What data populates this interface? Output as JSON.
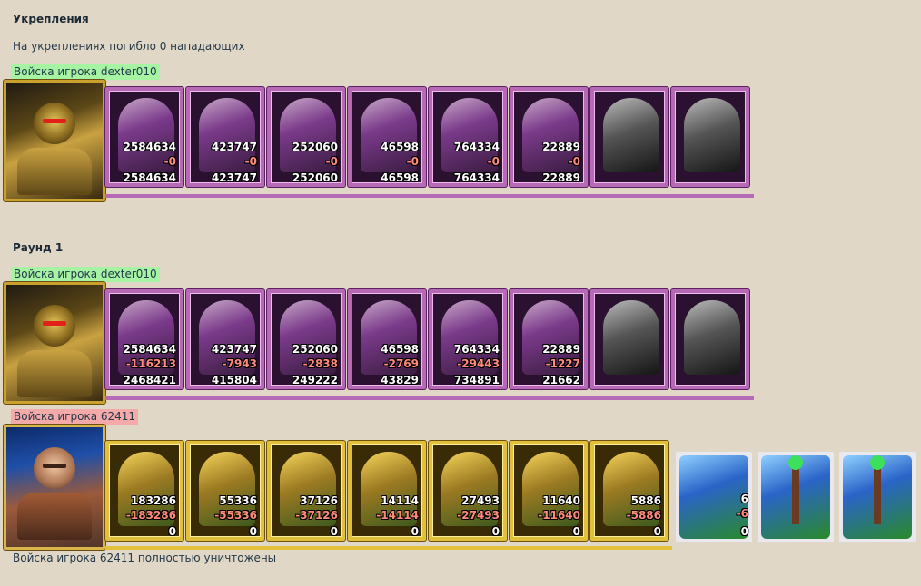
{
  "fort": {
    "heading": "Укрепления",
    "note": "На укреплениях погибло 0 нападающих",
    "player_label": "Войска игрока dexter010",
    "units": [
      {
        "n1": "2584634",
        "n2": "-0",
        "n3": "2584634"
      },
      {
        "n1": "423747",
        "n2": "-0",
        "n3": "423747"
      },
      {
        "n1": "252060",
        "n2": "-0",
        "n3": "252060"
      },
      {
        "n1": "46598",
        "n2": "-0",
        "n3": "46598"
      },
      {
        "n1": "764334",
        "n2": "-0",
        "n3": "764334"
      },
      {
        "n1": "22889",
        "n2": "-0",
        "n3": "22889"
      },
      {
        "n1": "",
        "n2": "",
        "n3": ""
      },
      {
        "n1": "",
        "n2": "",
        "n3": ""
      }
    ]
  },
  "round": {
    "heading": "Раунд 1",
    "attacker_label": "Войска игрока dexter010",
    "attacker_units": [
      {
        "n1": "2584634",
        "n2": "-116213",
        "n3": "2468421"
      },
      {
        "n1": "423747",
        "n2": "-7943",
        "n3": "415804"
      },
      {
        "n1": "252060",
        "n2": "-2838",
        "n3": "249222"
      },
      {
        "n1": "46598",
        "n2": "-2769",
        "n3": "43829"
      },
      {
        "n1": "764334",
        "n2": "-29443",
        "n3": "734891"
      },
      {
        "n1": "22889",
        "n2": "-1227",
        "n3": "21662"
      },
      {
        "n1": "",
        "n2": "",
        "n3": ""
      },
      {
        "n1": "",
        "n2": "",
        "n3": ""
      }
    ],
    "defender_label": "Войска игрока 62411",
    "defender_units": [
      {
        "n1": "183286",
        "n2": "-183286",
        "n3": "0"
      },
      {
        "n1": "55336",
        "n2": "-55336",
        "n3": "0"
      },
      {
        "n1": "37126",
        "n2": "-37126",
        "n3": "0"
      },
      {
        "n1": "14114",
        "n2": "-14114",
        "n3": "0"
      },
      {
        "n1": "27493",
        "n2": "-27493",
        "n3": "0"
      },
      {
        "n1": "11640",
        "n2": "-11640",
        "n3": "0"
      },
      {
        "n1": "5886",
        "n2": "-5886",
        "n3": "0"
      },
      {
        "n1": "6",
        "n2": "-6",
        "n3": "0"
      },
      {
        "n1": "",
        "n2": "",
        "n3": ""
      },
      {
        "n1": "",
        "n2": "",
        "n3": ""
      }
    ],
    "destroyed_note": "Войска игрока 62411 полностью уничтожены"
  }
}
